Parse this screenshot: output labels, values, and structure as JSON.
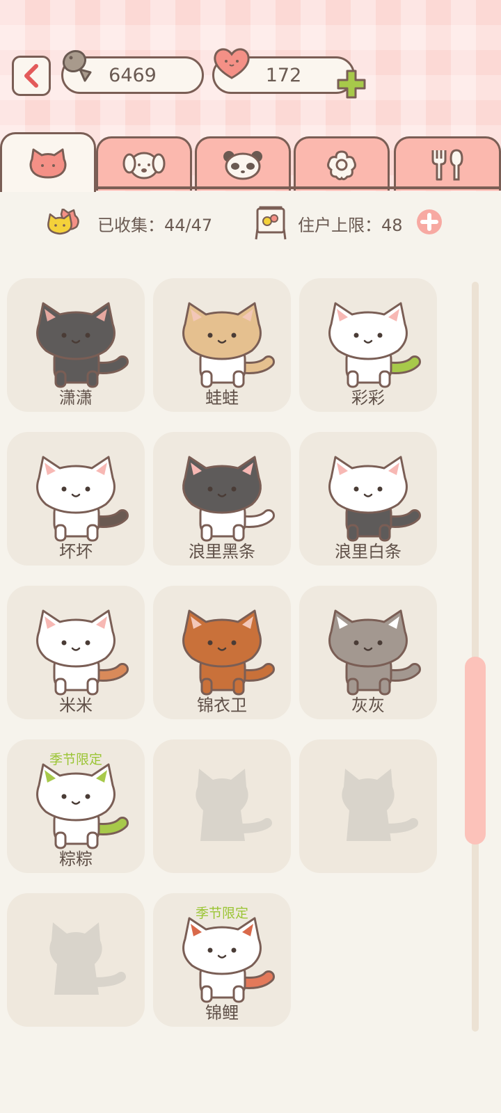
{
  "header": {
    "fish_count": "6469",
    "heart_count": "172"
  },
  "tabs": [
    {
      "icon": "cat-face-icon",
      "active": true
    },
    {
      "icon": "dog-face-icon",
      "active": false
    },
    {
      "icon": "panda-face-icon",
      "active": false
    },
    {
      "icon": "flower-icon",
      "active": false
    },
    {
      "icon": "fork-spoon-icon",
      "active": false
    }
  ],
  "stats": {
    "collected_label": "已收集：44/47",
    "capacity_label": "住户上限：48"
  },
  "cats": [
    {
      "name": "潇潇",
      "season": "",
      "body": "#5e5b5a",
      "belly": "#5e5b5a",
      "ear": "#e6a8a0",
      "tail": "#5e5b5a",
      "locked": false
    },
    {
      "name": "蛙蛙",
      "season": "",
      "body": "#e5c08f",
      "belly": "#ffffff",
      "ear": "#f3c7b8",
      "tail": "#e5c08f",
      "locked": false
    },
    {
      "name": "彩彩",
      "season": "",
      "body": "#ffffff",
      "belly": "#ffffff",
      "ear": "#f7b8b4",
      "tail": "#a7c94a",
      "locked": false
    },
    {
      "name": "坏坏",
      "season": "",
      "body": "#ffffff",
      "belly": "#ffffff",
      "ear": "#f7b8b4",
      "tail": "#6a5a52",
      "locked": false
    },
    {
      "name": "浪里黑条",
      "season": "",
      "body": "#5e5b5a",
      "belly": "#ffffff",
      "ear": "#f7b8b4",
      "tail": "#ffffff",
      "locked": false
    },
    {
      "name": "浪里白条",
      "season": "",
      "body": "#ffffff",
      "belly": "#5e5b5a",
      "ear": "#f7b8b4",
      "tail": "#5e5b5a",
      "locked": false
    },
    {
      "name": "米米",
      "season": "",
      "body": "#ffffff",
      "belly": "#ffffff",
      "ear": "#f7b8b4",
      "tail": "#d98a5a",
      "locked": false
    },
    {
      "name": "锦衣卫",
      "season": "",
      "body": "#c9713a",
      "belly": "#c9713a",
      "ear": "#f3c7b8",
      "tail": "#c9713a",
      "locked": false
    },
    {
      "name": "灰灰",
      "season": "",
      "body": "#a39890",
      "belly": "#a39890",
      "ear": "#ffffff",
      "tail": "#a39890",
      "locked": false
    },
    {
      "name": "粽粽",
      "season": "季节限定",
      "body": "#ffffff",
      "belly": "#ffffff",
      "ear": "#a7c94a",
      "tail": "#a7c94a",
      "locked": false
    },
    {
      "name": "",
      "season": "",
      "locked": true
    },
    {
      "name": "",
      "season": "",
      "locked": true
    },
    {
      "name": "",
      "season": "",
      "locked": true
    },
    {
      "name": "锦鲤",
      "season": "季节限定",
      "body": "#ffffff",
      "belly": "#ffffff",
      "ear": "#d9694a",
      "tail": "#e3795a",
      "locked": false
    }
  ],
  "colors": {
    "outline": "#7a5e55",
    "tab_inactive": "#fbb8ae",
    "card_bg": "#efe9df",
    "season_label": "#9bc535",
    "scroll_thumb": "#fcc2ba"
  }
}
